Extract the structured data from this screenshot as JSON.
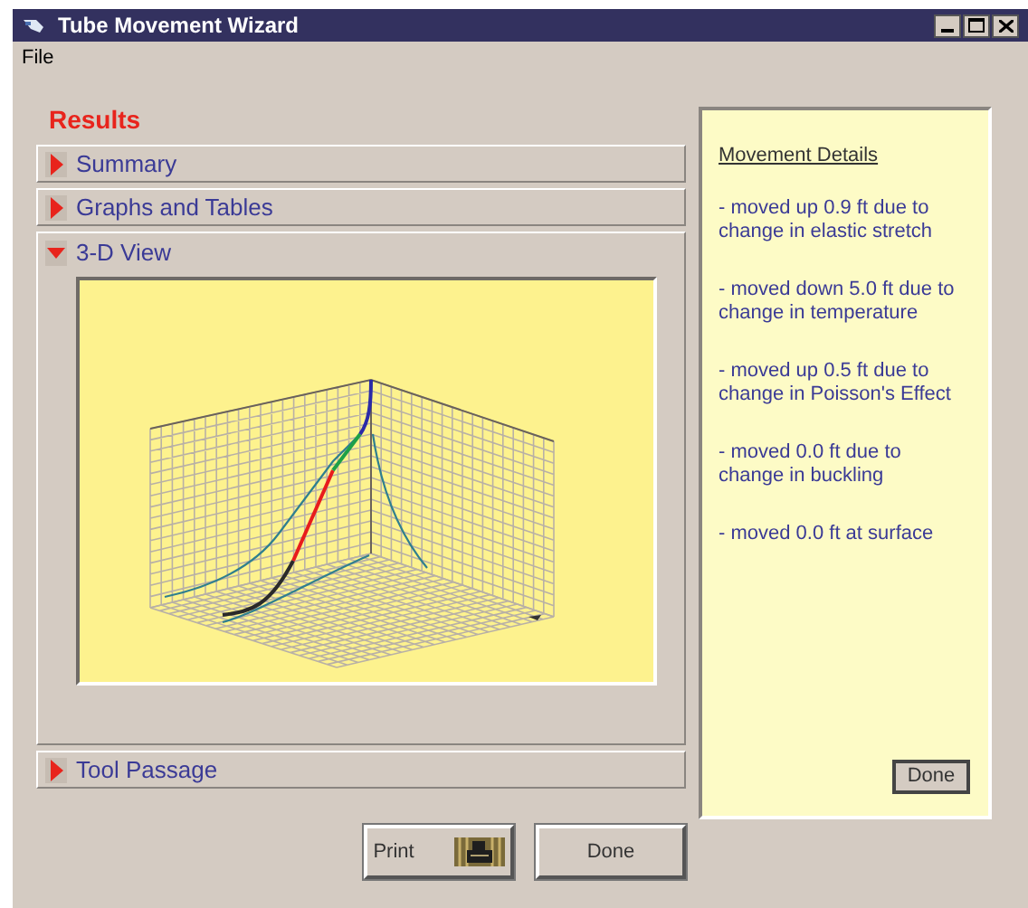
{
  "window": {
    "title": "Tube Movement Wizard"
  },
  "menu": [
    "File"
  ],
  "heading": "Results",
  "sections": [
    {
      "label": "Summary",
      "expanded": false
    },
    {
      "label": "Graphs and Tables",
      "expanded": false
    },
    {
      "label": "3-D View",
      "expanded": true
    },
    {
      "label": "Tool Passage",
      "expanded": false
    }
  ],
  "details": {
    "title": "Movement Details",
    "items": [
      "- moved up 0.9 ft due to change in elastic stretch",
      "- moved down 5.0 ft due to change in temperature",
      "- moved up 0.5 ft due to change in Poisson's Effect",
      "- moved 0.0 ft due to change in buckling",
      "- moved 0.0 ft at surface"
    ],
    "button": "Done"
  },
  "buttons": [
    {
      "label": "Print",
      "kind": "print"
    },
    {
      "label": "Done",
      "kind": "plain"
    }
  ]
}
